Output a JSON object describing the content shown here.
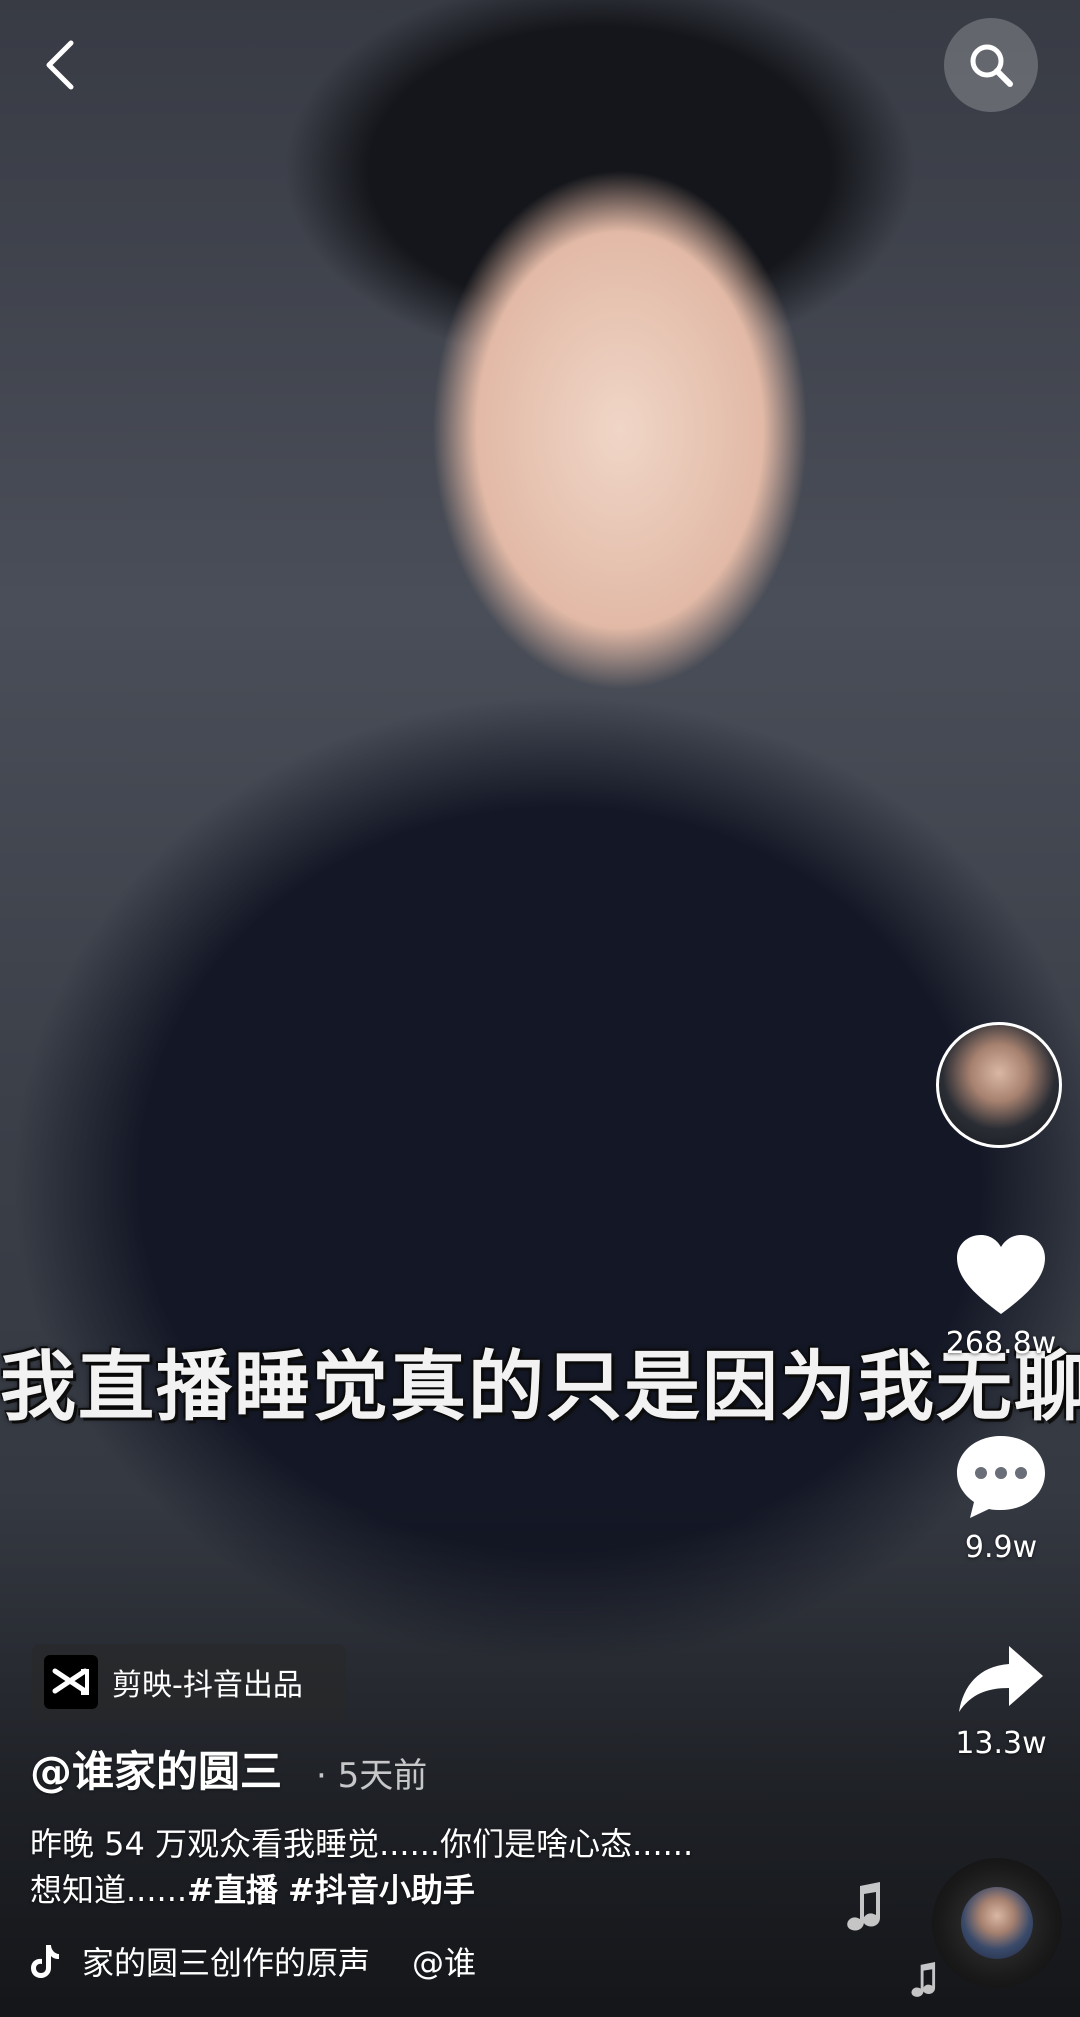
{
  "video": {
    "subtitle": "我直播睡觉真的只是因为我无聊"
  },
  "side_actions": {
    "like_count": "268.8w",
    "comment_count": "9.9w",
    "share_count": "13.3w"
  },
  "badge": {
    "label": "剪映-抖音出品"
  },
  "post": {
    "author": "@谁家的圆三",
    "time": "5天前",
    "desc_line1": "昨晚 54 万观众看我睡觉......你们是啥心态......",
    "desc_line2_prefix": "想知道......",
    "hashtags": [
      "#直播",
      "#抖音小助手"
    ]
  },
  "music": {
    "title": "家的圆三创作的原声",
    "author": "@谁"
  },
  "icons": {
    "back": "back-arrow-icon",
    "search": "search-icon",
    "like": "heart-icon",
    "comment": "comment-bubble-icon",
    "share": "share-arrow-icon",
    "tiktok": "tiktok-logo-icon",
    "capcut": "capcut-logo-icon"
  }
}
